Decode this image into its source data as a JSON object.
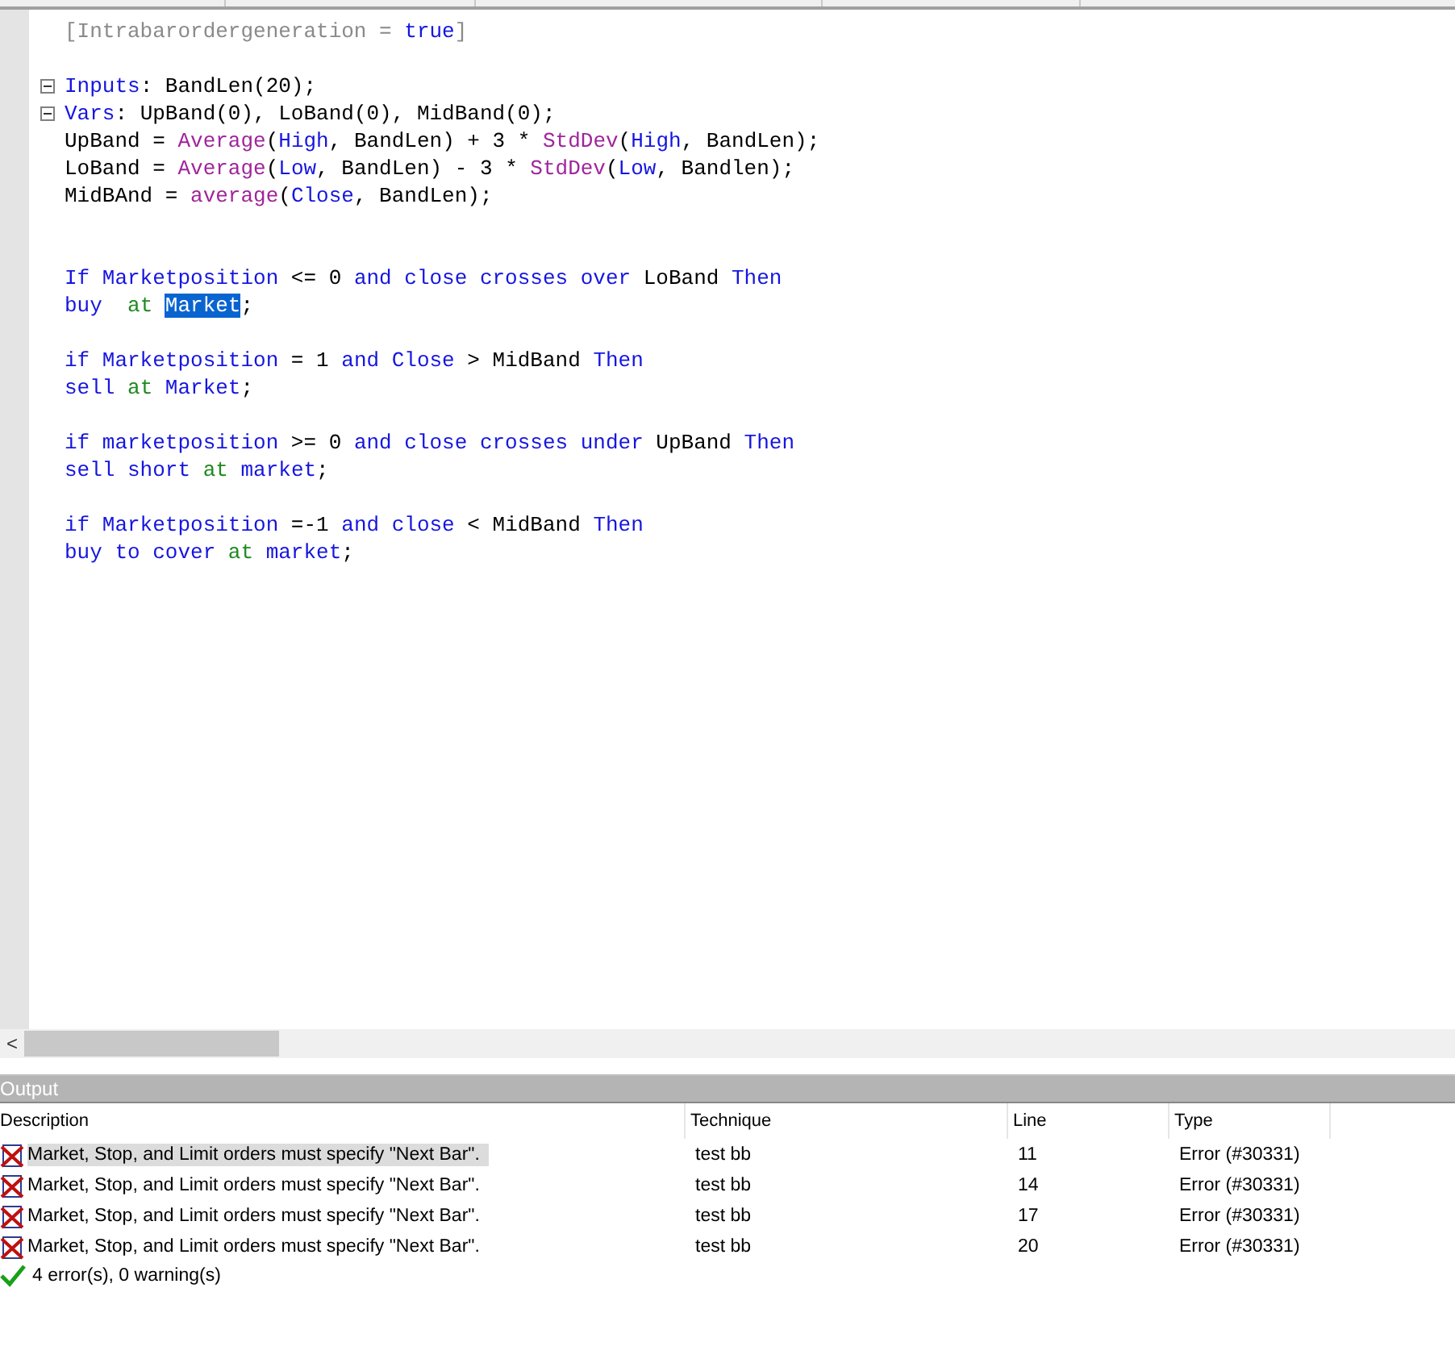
{
  "editor": {
    "lines": [
      {
        "kind": "code",
        "fold": false,
        "tokens": [
          {
            "kind": "attr",
            "text": "[Intrabarordergeneration = "
          },
          {
            "kind": "keyword",
            "text": "true"
          },
          {
            "kind": "attr",
            "text": "]"
          }
        ]
      },
      {
        "kind": "blank"
      },
      {
        "kind": "code",
        "fold": true,
        "tokens": [
          {
            "kind": "keyword",
            "text": "Inputs"
          },
          {
            "kind": "plain",
            "text": ": BandLen(20);"
          }
        ]
      },
      {
        "kind": "code",
        "fold": true,
        "tokens": [
          {
            "kind": "keyword",
            "text": "Vars"
          },
          {
            "kind": "plain",
            "text": ": UpBand(0), LoBand(0), MidBand(0);"
          }
        ]
      },
      {
        "kind": "code",
        "fold": false,
        "tokens": [
          {
            "kind": "plain",
            "text": "UpBand = "
          },
          {
            "kind": "func",
            "text": "Average"
          },
          {
            "kind": "plain",
            "text": "("
          },
          {
            "kind": "keyword",
            "text": "High"
          },
          {
            "kind": "plain",
            "text": ", BandLen) + 3 * "
          },
          {
            "kind": "func",
            "text": "StdDev"
          },
          {
            "kind": "plain",
            "text": "("
          },
          {
            "kind": "keyword",
            "text": "High"
          },
          {
            "kind": "plain",
            "text": ", BandLen);"
          }
        ]
      },
      {
        "kind": "code",
        "fold": false,
        "tokens": [
          {
            "kind": "plain",
            "text": "LoBand = "
          },
          {
            "kind": "func",
            "text": "Average"
          },
          {
            "kind": "plain",
            "text": "("
          },
          {
            "kind": "keyword",
            "text": "Low"
          },
          {
            "kind": "plain",
            "text": ", BandLen) - 3 * "
          },
          {
            "kind": "func",
            "text": "StdDev"
          },
          {
            "kind": "plain",
            "text": "("
          },
          {
            "kind": "keyword",
            "text": "Low"
          },
          {
            "kind": "plain",
            "text": ", Bandlen);"
          }
        ]
      },
      {
        "kind": "code",
        "fold": false,
        "tokens": [
          {
            "kind": "plain",
            "text": "MidBAnd = "
          },
          {
            "kind": "func",
            "text": "average"
          },
          {
            "kind": "plain",
            "text": "("
          },
          {
            "kind": "keyword",
            "text": "Close"
          },
          {
            "kind": "plain",
            "text": ", BandLen);"
          }
        ]
      },
      {
        "kind": "blank"
      },
      {
        "kind": "blank"
      },
      {
        "kind": "code",
        "fold": false,
        "tokens": [
          {
            "kind": "keyword",
            "text": "If Marketposition"
          },
          {
            "kind": "plain",
            "text": " <= 0 "
          },
          {
            "kind": "keyword",
            "text": "and close crosses over"
          },
          {
            "kind": "plain",
            "text": " LoBand "
          },
          {
            "kind": "keyword",
            "text": "Then"
          }
        ]
      },
      {
        "kind": "code",
        "fold": false,
        "tokens": [
          {
            "kind": "keyword",
            "text": "buy  "
          },
          {
            "kind": "reserved",
            "text": "at "
          },
          {
            "kind": "selected",
            "text": "Market"
          },
          {
            "kind": "plain",
            "text": ";"
          }
        ]
      },
      {
        "kind": "blank"
      },
      {
        "kind": "code",
        "fold": false,
        "tokens": [
          {
            "kind": "keyword",
            "text": "if Marketposition"
          },
          {
            "kind": "plain",
            "text": " = 1 "
          },
          {
            "kind": "keyword",
            "text": "and Close"
          },
          {
            "kind": "plain",
            "text": " > MidBand "
          },
          {
            "kind": "keyword",
            "text": "Then"
          }
        ]
      },
      {
        "kind": "code",
        "fold": false,
        "tokens": [
          {
            "kind": "keyword",
            "text": "sell "
          },
          {
            "kind": "reserved",
            "text": "at"
          },
          {
            "kind": "keyword",
            "text": " Market"
          },
          {
            "kind": "plain",
            "text": ";"
          }
        ]
      },
      {
        "kind": "blank"
      },
      {
        "kind": "code",
        "fold": false,
        "tokens": [
          {
            "kind": "keyword",
            "text": "if marketposition"
          },
          {
            "kind": "plain",
            "text": " >= 0 "
          },
          {
            "kind": "keyword",
            "text": "and close crosses under"
          },
          {
            "kind": "plain",
            "text": " UpBand "
          },
          {
            "kind": "keyword",
            "text": "Then"
          }
        ]
      },
      {
        "kind": "code",
        "fold": false,
        "tokens": [
          {
            "kind": "keyword",
            "text": "sell short "
          },
          {
            "kind": "reserved",
            "text": "at"
          },
          {
            "kind": "keyword",
            "text": " market"
          },
          {
            "kind": "plain",
            "text": ";"
          }
        ]
      },
      {
        "kind": "blank"
      },
      {
        "kind": "code",
        "fold": false,
        "tokens": [
          {
            "kind": "keyword",
            "text": "if Marketposition"
          },
          {
            "kind": "plain",
            "text": " =-1 "
          },
          {
            "kind": "keyword",
            "text": "and close"
          },
          {
            "kind": "plain",
            "text": " < MidBand "
          },
          {
            "kind": "keyword",
            "text": "Then"
          }
        ]
      },
      {
        "kind": "code",
        "fold": false,
        "tokens": [
          {
            "kind": "keyword",
            "text": "buy to cover "
          },
          {
            "kind": "reserved",
            "text": "at"
          },
          {
            "kind": "keyword",
            "text": " market"
          },
          {
            "kind": "plain",
            "text": ";"
          }
        ]
      }
    ],
    "scroll_left": "<"
  },
  "output": {
    "title": "Output",
    "columns": [
      "Description",
      "Technique",
      "Line",
      "Type"
    ],
    "rows": [
      {
        "selected": true,
        "description": "Market, Stop, and Limit orders must specify \"Next Bar\".",
        "technique": "test bb",
        "line": "11",
        "type": "Error (#30331)"
      },
      {
        "selected": false,
        "description": "Market, Stop, and Limit orders must specify \"Next Bar\".",
        "technique": "test bb",
        "line": "14",
        "type": "Error (#30331)"
      },
      {
        "selected": false,
        "description": "Market, Stop, and Limit orders must specify \"Next Bar\".",
        "technique": "test bb",
        "line": "17",
        "type": "Error (#30331)"
      },
      {
        "selected": false,
        "description": "Market, Stop, and Limit orders must specify \"Next Bar\".",
        "technique": "test bb",
        "line": "20",
        "type": "Error (#30331)"
      }
    ],
    "summary": "4 error(s), 0 warning(s)"
  }
}
